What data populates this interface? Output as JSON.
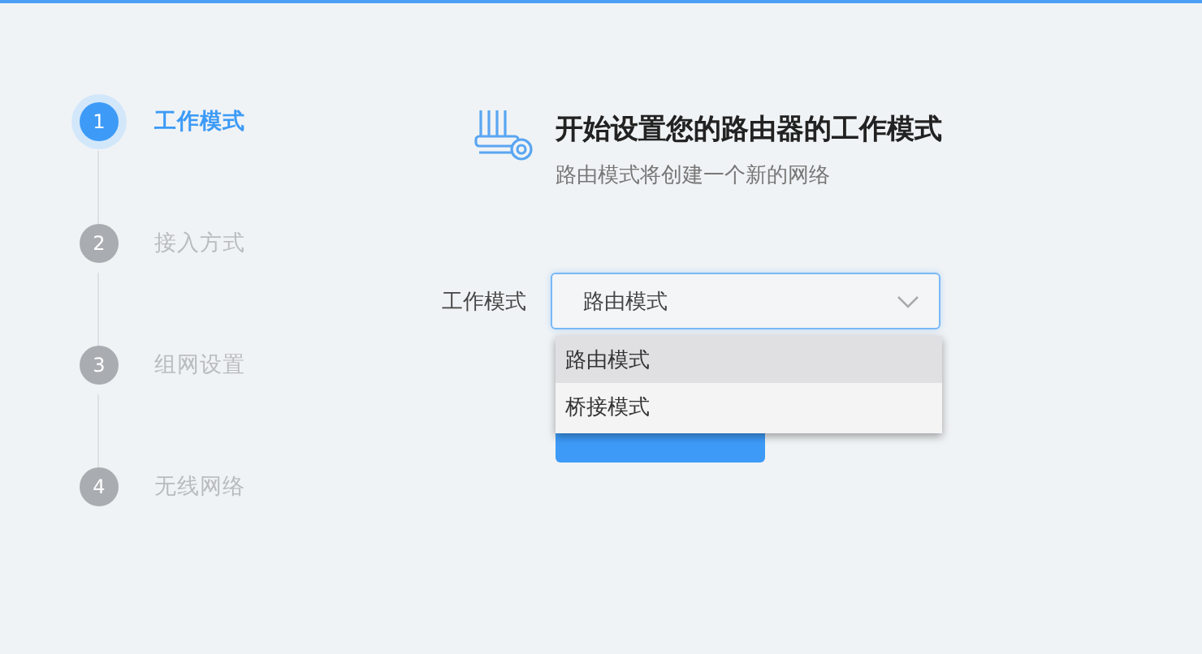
{
  "steps": [
    {
      "number": "1",
      "label": "工作模式",
      "selected": true
    },
    {
      "number": "2",
      "label": "接入方式",
      "selected": false
    },
    {
      "number": "3",
      "label": "组网设置",
      "selected": false
    },
    {
      "number": "4",
      "label": "无线网络",
      "selected": false
    }
  ],
  "header": {
    "title": "开始设置您的路由器的工作模式",
    "subtitle": "路由模式将创建一个新的网络"
  },
  "form": {
    "label": "工作模式",
    "value": "路由模式",
    "expanded": true,
    "options": [
      {
        "label": "路由模式",
        "selected": true
      },
      {
        "label": "桥接模式",
        "selected": false
      }
    ]
  }
}
